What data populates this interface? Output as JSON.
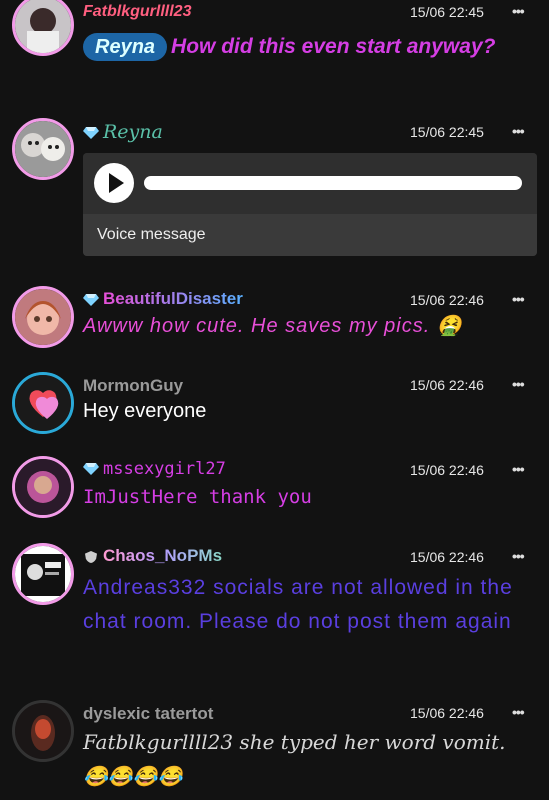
{
  "messages": [
    {
      "username": "Fatblkgurllll23",
      "time": "15/06 22:45",
      "more": "•••",
      "mention": "Reyna",
      "text": "How did this even start anyway?"
    },
    {
      "username": "Reyna",
      "time": "15/06 22:45",
      "more": "•••",
      "voice_caption": "Voice message"
    },
    {
      "username": "BeautifulDisaster",
      "time": "15/06 22:46",
      "more": "•••",
      "text": "Awww how cute. He saves my pics. 🤮"
    },
    {
      "username": "MormonGuy",
      "time": "15/06 22:46",
      "more": "•••",
      "text": "Hey everyone"
    },
    {
      "username": "mssexygirl27",
      "time": "15/06 22:46",
      "more": "•••",
      "text": "ImJustHere thank you"
    },
    {
      "username": "Chaos_NoPMs",
      "time": "15/06 22:46",
      "more": "•••",
      "text": "Andreas332 socials are not allowed in the chat room. Please do not post them again"
    },
    {
      "username": "dyslexic tatertot",
      "time": "15/06 22:46",
      "more": "•••",
      "text": "Fatblkgurllll23 she typed her word vomit. 😂😂😂😂"
    }
  ],
  "colors": {
    "background": "#121212",
    "pink": "#e84fd8",
    "purple": "#5a3fe0",
    "mention": "#1d66a6",
    "diamond": "#7fd3ff"
  }
}
